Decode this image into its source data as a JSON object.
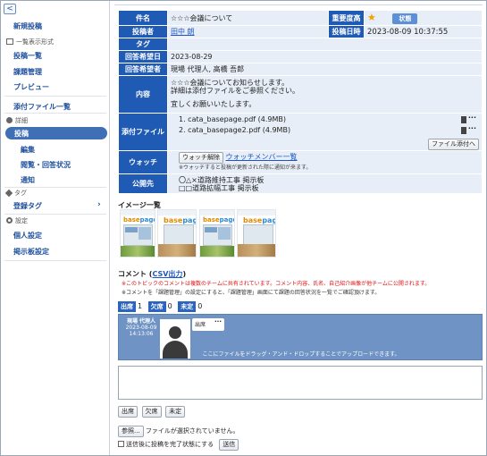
{
  "sidebar": {
    "collapse": "<",
    "new_post": "新規投稿",
    "list_section": "一覧表示形式",
    "post_list": "投稿一覧",
    "task_mgmt": "課題管理",
    "preview": "プレビュー",
    "attachments": "添付ファイル一覧",
    "detail_section": "詳細",
    "post": "投稿",
    "edit": "編集",
    "reply_status": "閲覧・回答状況",
    "notify": "通知",
    "tag_section": "タグ",
    "tag_register": "登録タグ",
    "settings_section": "設定",
    "personal_settings": "個人設定",
    "board_settings": "掲示板設定"
  },
  "detail": {
    "subject_label": "件名",
    "subject": "☆☆☆会議について",
    "importance_label": "重要度高",
    "status_button": "状態",
    "poster_label": "投稿者",
    "poster": "田中 朗",
    "post_date_label": "投稿日時",
    "post_date": "2023-08-09 10:37:55",
    "tag_label": "タグ",
    "due_label": "回答希望日",
    "due": "2023-08-29",
    "responders_label": "回答希望者",
    "responders": "現場 代理人, 高橋 吾郎",
    "content_label": "内容",
    "content_line1": "☆☆☆会議についてお知らせします。",
    "content_line2": "詳細は添付ファイルをご参照ください。",
    "content_line3": "宜しくお願いいたします。",
    "attach_label": "添付ファイル",
    "files": [
      "1.  cata_basepage.pdf (4.9MB)",
      "2.  cata_basepage2.pdf (4.9MB)"
    ],
    "attach_button": "ファイル添付へ",
    "watch_label": "ウォッチ",
    "watch_release": "ウォッチ解除",
    "watch_members": "ウォッチメンバー一覧",
    "watch_note": "※ウォッチすると投稿が更新された際に通知が来ます。",
    "public_label": "公開先",
    "public1": "〇△×道路維持工事 掲示板",
    "public2": "□□道路拡幅工事 掲示板"
  },
  "images": {
    "title": "イメージ一覧",
    "logo_a": "base",
    "logo_b": "page"
  },
  "comments": {
    "title": "コメント",
    "csv": "CSV出力",
    "red_note": "※このトピックのコメントは複数のチームに共有されています。コメント内容、氏名、自己紹介画像が他チームに公開されます。",
    "gray_note": "※コメントを「課題管理」の設定にすると、「課題管理」画面にて課題の回答状況を一覧でご確認頂けます。",
    "present_label": "出席",
    "present": "1",
    "absent_label": "欠席",
    "absent": "0",
    "undecided_label": "未定",
    "undecided": "0",
    "author": "現場 代理人",
    "author_date": "2023-08-09",
    "author_time": "14:13:06",
    "bubble": "出席",
    "drop_hint": "ここにファイルをドラッグ・アンド・ドロップすることでアップロードできます。",
    "quick": [
      "出席",
      "欠席",
      "未定"
    ],
    "browse": "参照...",
    "no_file": "ファイルが選択されていません。",
    "complete_check": "送信後に投稿を完了状態にする",
    "send": "送信"
  }
}
